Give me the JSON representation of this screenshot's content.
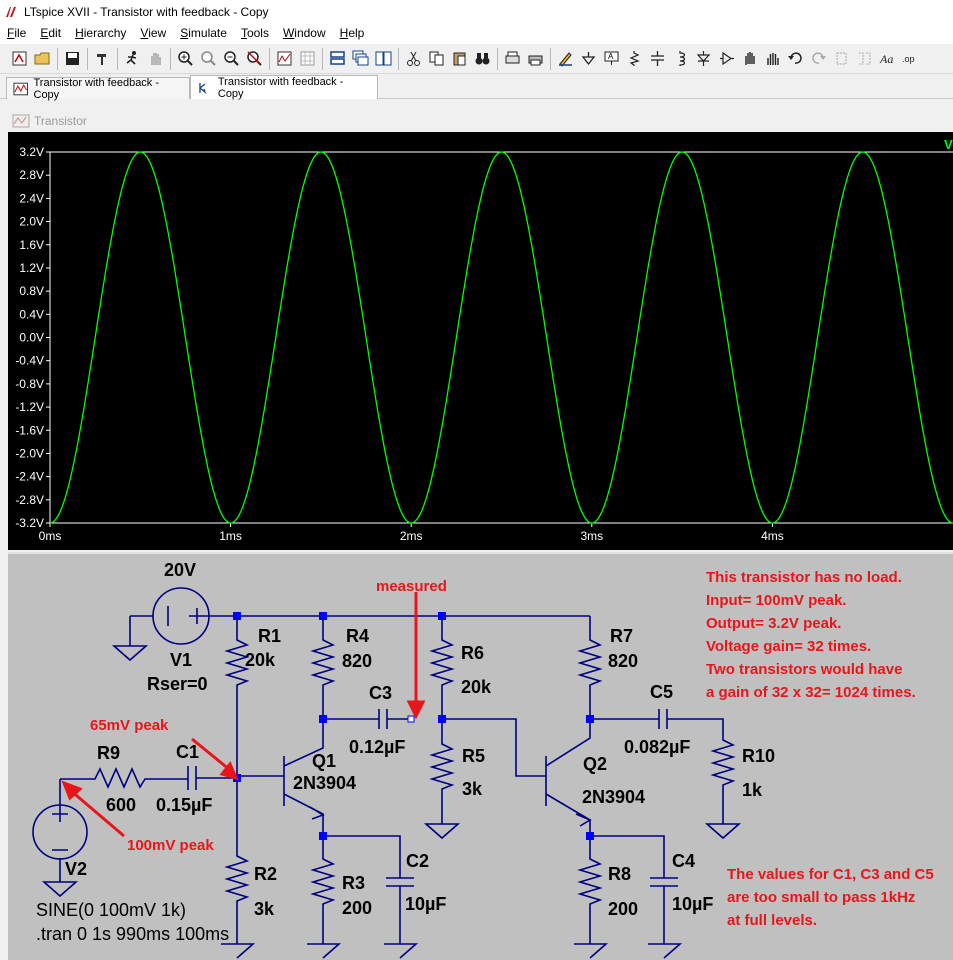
{
  "window": {
    "title": "LTspice XVII - Transistor with  feedback - Copy"
  },
  "menu": [
    "File",
    "Edit",
    "Hierarchy",
    "View",
    "Simulate",
    "Tools",
    "Window",
    "Help"
  ],
  "tabs": [
    {
      "label": "Transistor with  feedback - Copy",
      "icon": "waveform-icon"
    },
    {
      "label": "Transistor with  feedback - Copy",
      "icon": "schematic-icon"
    }
  ],
  "plot_window": {
    "title": "Transistor",
    "trace_label": "V"
  },
  "chart_data": {
    "type": "line",
    "x_unit": "ms",
    "xlim": [
      0,
      5
    ],
    "ylim": [
      -3.2,
      3.2
    ],
    "x_ticks": [
      "0ms",
      "1ms",
      "2ms",
      "3ms",
      "4ms"
    ],
    "y_ticks": [
      "3.2V",
      "2.8V",
      "2.4V",
      "2.0V",
      "1.6V",
      "1.2V",
      "0.8V",
      "0.4V",
      "0.0V",
      "-0.4V",
      "-0.8V",
      "-1.2V",
      "-1.6V",
      "-2.0V",
      "-2.4V",
      "-2.8V",
      "-3.2V"
    ],
    "grid": false,
    "series": [
      {
        "name": "V",
        "color": "#00ff00",
        "waveform": "sine",
        "amplitude_v": 3.2,
        "frequency_khz": 1,
        "first_peak_ms": 0.5
      }
    ]
  },
  "schematic": {
    "components": {
      "v1": {
        "name": "V1",
        "value": "20V",
        "extra": "Rser=0"
      },
      "v2": {
        "name": "V2"
      },
      "r1": {
        "name": "R1",
        "value": "20k"
      },
      "r2": {
        "name": "R2",
        "value": "3k"
      },
      "r3": {
        "name": "R3",
        "value": "200"
      },
      "r4": {
        "name": "R4",
        "value": "820"
      },
      "r5": {
        "name": "R5",
        "value": "3k"
      },
      "r6": {
        "name": "R6",
        "value": "20k"
      },
      "r7": {
        "name": "R7",
        "value": "820"
      },
      "r8": {
        "name": "R8",
        "value": "200"
      },
      "r9": {
        "name": "R9",
        "value": "600"
      },
      "r10": {
        "name": "R10",
        "value": "1k"
      },
      "c1": {
        "name": "C1",
        "value": "0.15µF"
      },
      "c2": {
        "name": "C2",
        "value": "10µF"
      },
      "c3": {
        "name": "C3",
        "value": "0.12µF"
      },
      "c4": {
        "name": "C4",
        "value": "10µF"
      },
      "c5": {
        "name": "C5",
        "value": "0.082µF"
      },
      "q1": {
        "name": "Q1",
        "model": "2N3904"
      },
      "q2": {
        "name": "Q2",
        "model": "2N3904"
      }
    },
    "directives": [
      "SINE(0 100mV 1k)",
      ".tran 0 1s 990ms 100ms"
    ],
    "annotations": {
      "measured": "measured",
      "peak_65": "65mV peak",
      "peak_100": "100mV peak",
      "note_top": [
        "This transistor has no load.",
        "Input= 100mV peak.",
        "Output= 3.2V peak.",
        "Voltage gain= 32 times.",
        "Two transistors would have",
        "a gain of 32 x 32= 1024 times."
      ],
      "note_bottom": [
        "The values for C1, C3 and C5",
        "are too small to pass 1kHz",
        "at full levels."
      ]
    },
    "colors": {
      "wire": "#000080",
      "node": "#0000ff",
      "annotation": "#e8161b",
      "background": "#c0c0c0"
    }
  }
}
